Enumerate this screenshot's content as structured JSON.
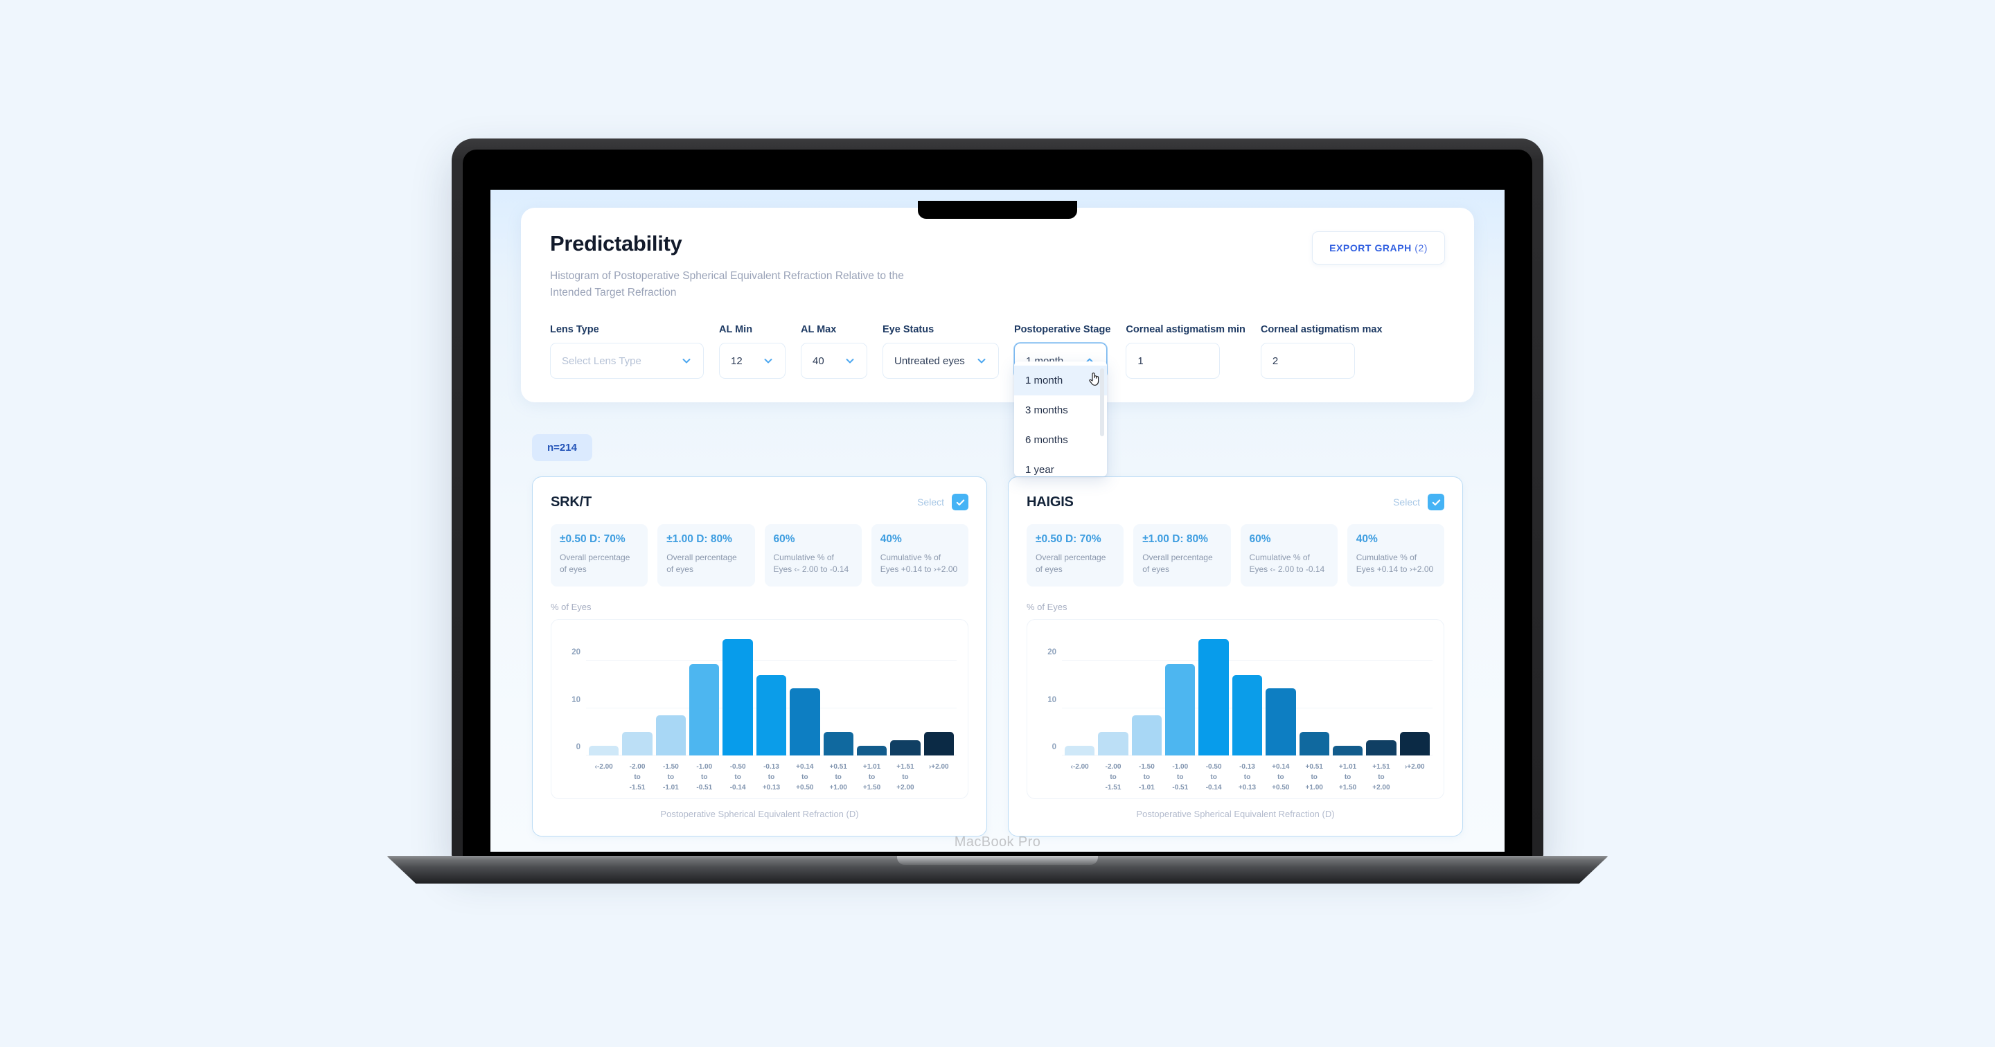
{
  "device": {
    "label": "MacBook Pro"
  },
  "header": {
    "title": "Predictability",
    "subtitle": "Histogram of Postoperative Spherical Equivalent Refraction Relative to the Intended Target Refraction",
    "export_label": "EXPORT GRAPH",
    "export_count": "(2)"
  },
  "filters": [
    {
      "label": "Lens Type",
      "value": "",
      "placeholder": "Select Lens Type",
      "type": "select",
      "icon": "chevron-down-icon"
    },
    {
      "label": "AL Min",
      "value": "12",
      "placeholder": "",
      "type": "select",
      "icon": "chevron-down-icon"
    },
    {
      "label": "AL Max",
      "value": "40",
      "placeholder": "",
      "type": "select",
      "icon": "chevron-down-icon"
    },
    {
      "label": "Eye Status",
      "value": "Untreated eyes",
      "placeholder": "",
      "type": "select",
      "icon": "chevron-down-icon"
    },
    {
      "label": "Postoperative Stage",
      "value": "1 month",
      "placeholder": "",
      "type": "select-open",
      "icon": "chevron-up-icon"
    },
    {
      "label": "Corneal astigmatism min",
      "value": "1",
      "placeholder": "",
      "type": "input",
      "icon": ""
    },
    {
      "label": "Corneal astigmatism max",
      "value": "2",
      "placeholder": "",
      "type": "input",
      "icon": ""
    }
  ],
  "stage_menu": {
    "open": true,
    "options": [
      "1 month",
      "3 months",
      "6 months",
      "1 year"
    ],
    "highlighted": "1 month",
    "cursor": "pointing-hand-cursor"
  },
  "sample": {
    "badge": "n=214"
  },
  "cards": [
    {
      "title": "SRK/T",
      "select_label": "Select",
      "selected": true,
      "metrics": [
        {
          "value": "±0.50 D: 70%",
          "desc": "Overall percentage of eyes"
        },
        {
          "value": "±1.00 D: 80%",
          "desc": "Overall percentage of eyes"
        },
        {
          "value": "60%",
          "desc": "Cumulative % of Eyes ‹- 2.00 to -0.14"
        },
        {
          "value": "40%",
          "desc": "Cumulative % of Eyes +0.14 to ›+2.00"
        }
      ],
      "y_axis_title": "% of Eyes",
      "caption": "Postoperative Spherical Equivalent Refraction (D)"
    },
    {
      "title": "HAIGIS",
      "select_label": "Select",
      "selected": true,
      "metrics": [
        {
          "value": "±0.50 D: 70%",
          "desc": "Overall percentage of eyes"
        },
        {
          "value": "±1.00 D: 80%",
          "desc": "Overall percentage of eyes"
        },
        {
          "value": "60%",
          "desc": "Cumulative % of Eyes ‹- 2.00 to -0.14"
        },
        {
          "value": "40%",
          "desc": "Cumulative % of Eyes +0.14 to ›+2.00"
        }
      ],
      "y_axis_title": "% of Eyes",
      "caption": "Postoperative Spherical Equivalent Refraction (D)"
    }
  ],
  "chart_data": [
    {
      "type": "bar",
      "title": "SRK/T",
      "xlabel": "Postoperative Spherical Equivalent Refraction (D)",
      "ylabel": "% of Eyes",
      "ylim": [
        0,
        26
      ],
      "yticks": [
        0,
        10,
        20
      ],
      "grid": true,
      "legend": "none",
      "categories": [
        "‹-2.00",
        "-2.00\nto\n-1.51",
        "-1.50\nto\n-1.01",
        "-1.00\nto\n-0.51",
        "-0.50\nto\n-0.14",
        "-0.13\nto\n+0.13",
        "+0.14\nto\n+0.50",
        "+0.51\nto\n+1.00",
        "+1.01\nto\n+1.50",
        "+1.51\nto\n+2.00",
        "›+2.00"
      ],
      "values": [
        2,
        5,
        8.5,
        19.3,
        24.5,
        17,
        14.2,
        5,
        2,
        3.2,
        5
      ],
      "colors": [
        "#cfe8f8",
        "#bcdff6",
        "#a8d7f5",
        "#4db6f0",
        "#079ceb",
        "#0b9de9",
        "#0d7ec2",
        "#10699f",
        "#125c8c",
        "#103f63",
        "#0b2a45"
      ]
    },
    {
      "type": "bar",
      "title": "HAIGIS",
      "xlabel": "Postoperative Spherical Equivalent Refraction (D)",
      "ylabel": "% of Eyes",
      "ylim": [
        0,
        26
      ],
      "yticks": [
        0,
        10,
        20
      ],
      "grid": true,
      "legend": "none",
      "categories": [
        "‹-2.00",
        "-2.00\nto\n-1.51",
        "-1.50\nto\n-1.01",
        "-1.00\nto\n-0.51",
        "-0.50\nto\n-0.14",
        "-0.13\nto\n+0.13",
        "+0.14\nto\n+0.50",
        "+0.51\nto\n+1.00",
        "+1.01\nto\n+1.50",
        "+1.51\nto\n+2.00",
        "›+2.00"
      ],
      "values": [
        2,
        5,
        8.5,
        19.3,
        24.5,
        17,
        14.2,
        5,
        2,
        3.2,
        5
      ],
      "colors": [
        "#cfe8f8",
        "#bcdff6",
        "#a8d7f5",
        "#4db6f0",
        "#079ceb",
        "#0b9de9",
        "#0d7ec2",
        "#10699f",
        "#125c8c",
        "#103f63",
        "#0b2a45"
      ]
    }
  ],
  "colors": {
    "accent": "#2f5ee0",
    "checkbox": "#45b3f5",
    "metric_value": "#3d9de0",
    "badge_bg": "#dbeafe",
    "badge_text": "#2454b8",
    "page_bg": "#eff6fd"
  }
}
